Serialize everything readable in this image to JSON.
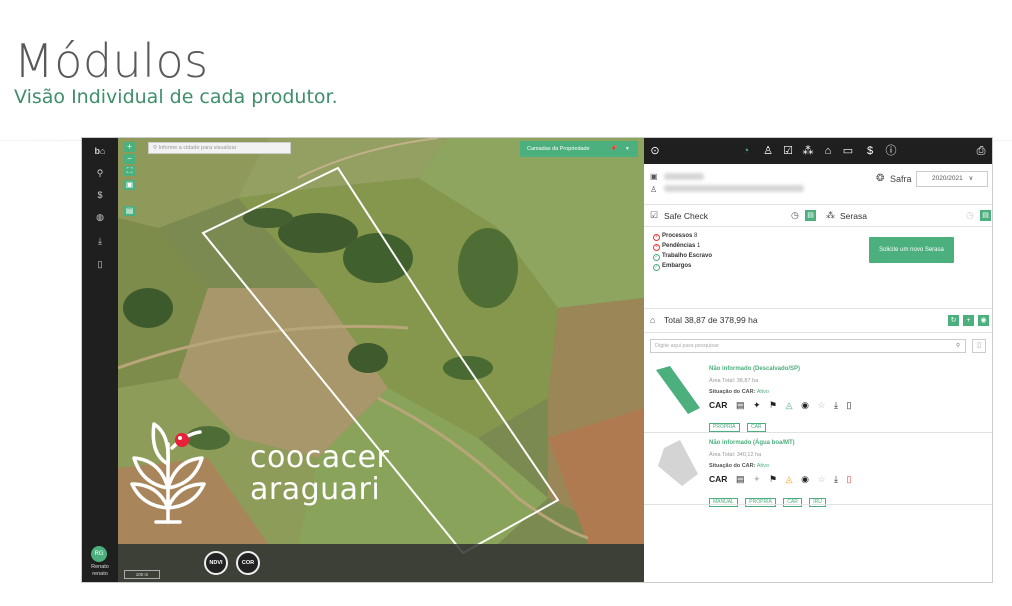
{
  "slide": {
    "title": "Módulos",
    "subtitle": "Visão Individual de cada produtor."
  },
  "leftbar": {
    "user_initials": "RG",
    "user_name": "Renato",
    "user_login": "renato"
  },
  "map": {
    "search_placeholder": "Informe a cidade para visualizar",
    "layers_label": "Camadas da Propriedade",
    "btn_ndvi": "NDVI",
    "btn_cor": "COR",
    "scale": "100 m",
    "logo_line1": "coocacer",
    "logo_line2": "araguari"
  },
  "panel": {
    "safra_label": "Safra",
    "safra_value": "2020/2021",
    "safe_check_title": "Safe Check",
    "serasa_title": "Serasa",
    "checks": [
      {
        "label": "Processos",
        "value": "8",
        "status": "bad"
      },
      {
        "label": "Pendências",
        "value": "1",
        "status": "bad"
      },
      {
        "label": "Trabalho Escravo",
        "value": "",
        "status": "ok"
      },
      {
        "label": "Embargos",
        "value": "",
        "status": "ok"
      }
    ],
    "serasa_button": "Solicite um novo Serasa",
    "total_text": "Total 38,87 de 378,99 ha",
    "search_placeholder": "Digite aqui para pesquisar",
    "properties": [
      {
        "name": "Não informado (Descalvado/SP)",
        "area": "Área Total: 38,87 ha",
        "car_label": "Situação do CAR:",
        "car_status": "Ativo",
        "car_text": "CAR",
        "tags": [
          "PRÓPRIA",
          "CAR"
        ]
      },
      {
        "name": "Não informado (Água boa/MT)",
        "area": "Área Total: 340,12 ha",
        "car_label": "Situação do CAR:",
        "car_status": "Ativo",
        "car_text": "CAR",
        "tags": [
          "MANUAL",
          "PRÓPRIA",
          "CAR",
          "IRU"
        ]
      }
    ]
  },
  "colors": {
    "accent": "#4caf7e",
    "dark": "#1f1f1f",
    "danger": "#e53935"
  }
}
